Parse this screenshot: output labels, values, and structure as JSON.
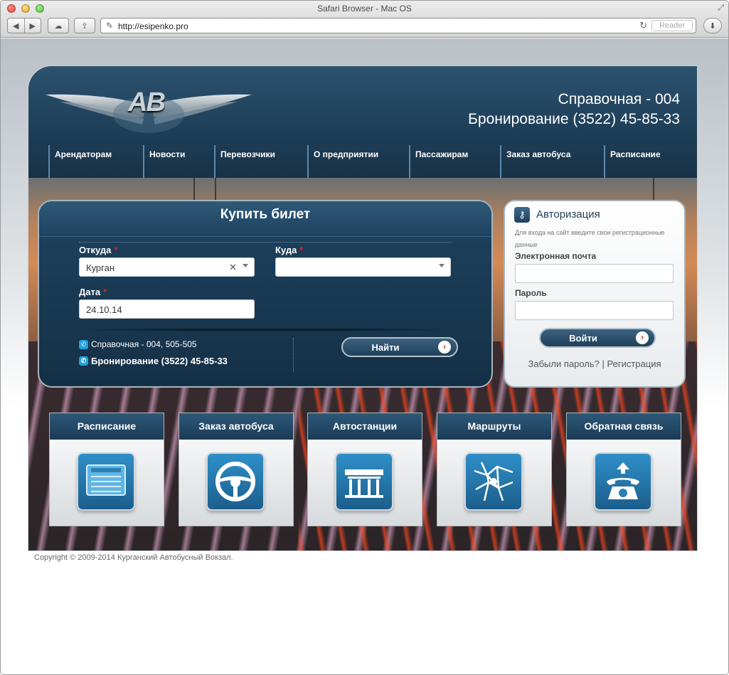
{
  "browser": {
    "window_title": "Safari Browser - Mac OS",
    "url": "http://esipenko.pro",
    "reader_label": "Reader"
  },
  "site": {
    "logo_text": "AB",
    "phones": {
      "info": "Справочная - 004",
      "booking": "Бронирование (3522) 45-85-33"
    },
    "menu": [
      "Арендаторам",
      "Новости",
      "Перевозчики",
      "О предприятии",
      "Пассажирам",
      "Заказ автобуса",
      "Расписание"
    ],
    "ticket": {
      "title": "Купить билет",
      "from_label": "Откуда",
      "from_value": "Курган",
      "to_label": "Куда",
      "to_value": "",
      "date_label": "Дата",
      "date_value": "24.10.14",
      "required_mark": "*",
      "info_phone": "Справочная - 004, 505-505",
      "booking_phone": "Бронирование (3522) 45-85-33",
      "search_button": "Найти"
    },
    "auth": {
      "title": "Авторизация",
      "hint": "Для входа на сайт введите свои регистрационные данные",
      "email_label": "Электронная почта",
      "password_label": "Пароль",
      "login_button": "Войти",
      "forgot_link": "Забыли пароль?",
      "separator": "|",
      "register_link": "Регистрация"
    },
    "tiles": [
      {
        "label": "Расписание",
        "icon": "schedule-board-icon"
      },
      {
        "label": "Заказ автобуса",
        "icon": "steering-wheel-icon"
      },
      {
        "label": "Автостанции",
        "icon": "bus-station-icon"
      },
      {
        "label": "Маршруты",
        "icon": "route-map-icon"
      },
      {
        "label": "Обратная связь",
        "icon": "telephone-icon"
      }
    ],
    "copyright": "Copyright © 2009-2014 Курганский Автобусный Вокзал."
  }
}
